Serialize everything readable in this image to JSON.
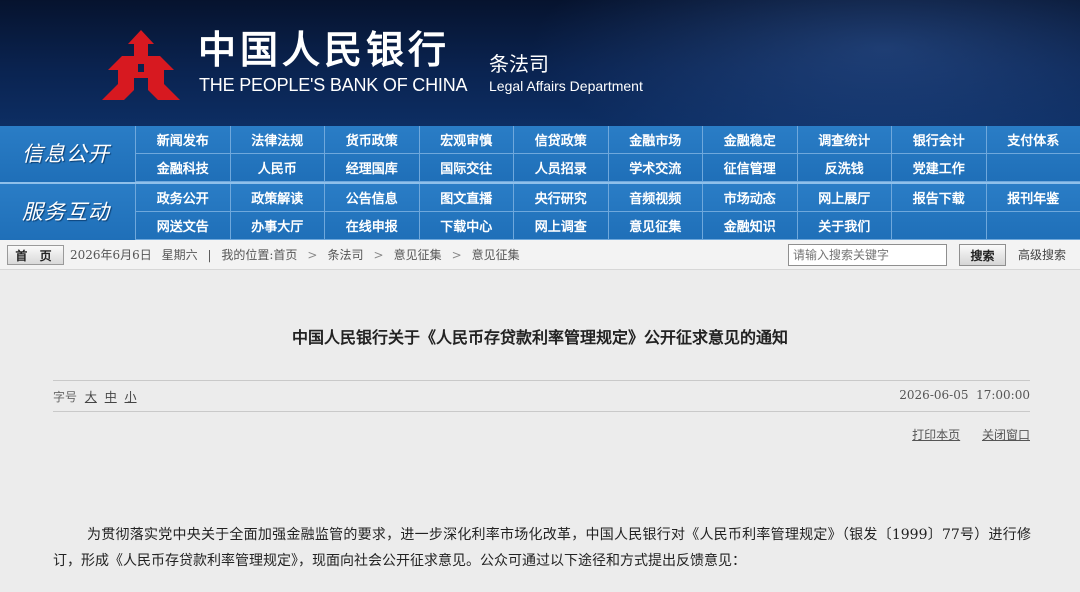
{
  "header": {
    "bank_name_cn": "中国人民银行",
    "bank_name_en": "THE PEOPLE'S BANK OF CHINA",
    "dept_cn": "条法司",
    "dept_en": "Legal Affairs Department",
    "logo_icon": "pboc-logo-icon",
    "logo_color": "#d71920"
  },
  "nav": {
    "section1_title": "信息公开",
    "section1_items": [
      "新闻发布",
      "法律法规",
      "货币政策",
      "宏观审慎",
      "信贷政策",
      "金融市场",
      "金融稳定",
      "调查统计",
      "银行会计",
      "支付体系",
      "金融科技",
      "人民币",
      "经理国库",
      "国际交往",
      "人员招录",
      "学术交流",
      "征信管理",
      "反洗钱",
      "党建工作",
      ""
    ],
    "section2_title": "服务互动",
    "section2_items": [
      "政务公开",
      "政策解读",
      "公告信息",
      "图文直播",
      "央行研究",
      "音频视频",
      "市场动态",
      "网上展厅",
      "报告下载",
      "报刊年鉴",
      "网送文告",
      "办事大厅",
      "在线申报",
      "下载中心",
      "网上调查",
      "意见征集",
      "金融知识",
      "关于我们",
      "",
      ""
    ]
  },
  "breadcrumb": {
    "home_label": "首 页",
    "date": "2026年6月6日",
    "weekday": "星期六",
    "location_prefix": "我的位置:",
    "items": [
      "首页",
      "条法司",
      "意见征集",
      "意见征集"
    ],
    "search_placeholder": "请输入搜索关键字",
    "search_label": "搜索",
    "advanced_search_label": "高级搜索"
  },
  "article": {
    "title": "中国人民银行关于《人民币存贷款利率管理规定》公开征求意见的通知",
    "font_size_label": "字号",
    "font_sizes": [
      "大",
      "中",
      "小"
    ],
    "publish_time": "2026-06-05  17:00:00",
    "print_label": "打印本页",
    "close_label": "关闭窗口",
    "paragraph": "为贯彻落实党中央关于全面加强金融监管的要求，进一步深化利率市场化改革，中国人民银行对《人民币利率管理规定》（银发〔1999〕77号）进行修订，形成《人民币存贷款利率管理规定》，现面向社会公开征求意见。公众可通过以下途径和方式提出反馈意见："
  }
}
